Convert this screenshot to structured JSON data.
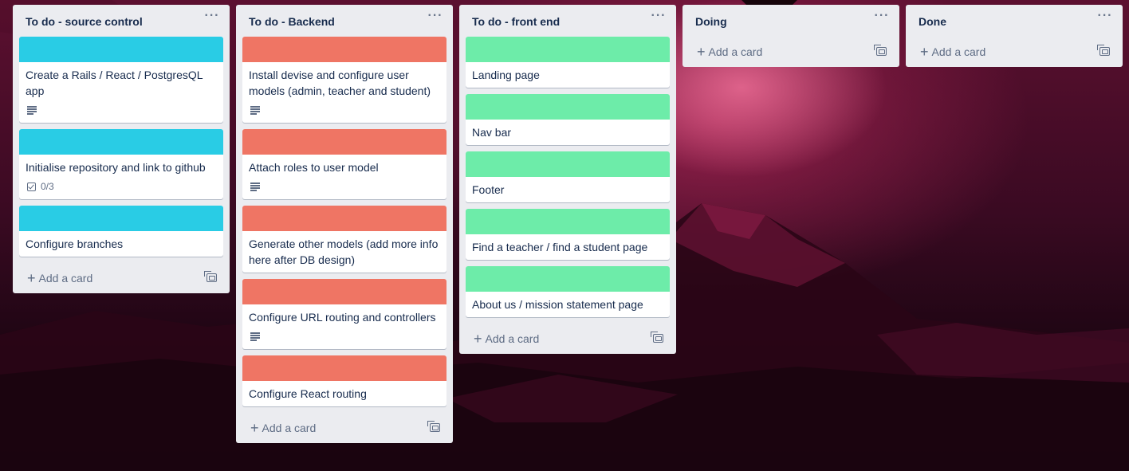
{
  "colors": {
    "label_source_control": "#29cce5",
    "label_backend": "#ef7564",
    "label_front_end": "#6deca9",
    "list_bg": "#ebecf0"
  },
  "lists": [
    {
      "title": "To do - source control",
      "menu": "···",
      "add_label": "Add a card",
      "cards": [
        {
          "title": "Create a Rails / React / PostgresQL app",
          "label_color": "#29cce5",
          "badges": "description"
        },
        {
          "title": "Initialise repository and link to github",
          "label_color": "#29cce5",
          "badges": "checklist",
          "checklist": "0/3"
        },
        {
          "title": "Configure branches",
          "label_color": "#29cce5",
          "badges": "none"
        }
      ]
    },
    {
      "title": "To do - Backend",
      "menu": "···",
      "add_label": "Add a card",
      "cards": [
        {
          "title": "Install devise and configure user models (admin, teacher and student)",
          "label_color": "#ef7564",
          "badges": "description"
        },
        {
          "title": "Attach roles to user model",
          "label_color": "#ef7564",
          "badges": "description"
        },
        {
          "title": "Generate other models (add more info here after DB design)",
          "label_color": "#ef7564",
          "badges": "none"
        },
        {
          "title": "Configure URL routing and controllers",
          "label_color": "#ef7564",
          "badges": "description"
        },
        {
          "title": "Configure React routing",
          "label_color": "#ef7564",
          "badges": "none"
        }
      ]
    },
    {
      "title": "To do - front end",
      "menu": "···",
      "add_label": "Add a card",
      "cards": [
        {
          "title": "Landing page",
          "label_color": "#6deca9",
          "badges": "none"
        },
        {
          "title": "Nav bar",
          "label_color": "#6deca9",
          "badges": "none"
        },
        {
          "title": "Footer",
          "label_color": "#6deca9",
          "badges": "none"
        },
        {
          "title": "Find a teacher / find a student page",
          "label_color": "#6deca9",
          "badges": "none"
        },
        {
          "title": "About us / mission statement page",
          "label_color": "#6deca9",
          "badges": "none"
        }
      ]
    },
    {
      "title": "Doing",
      "menu": "···",
      "add_label": "Add a card",
      "cards": []
    },
    {
      "title": "Done",
      "menu": "···",
      "add_label": "Add a card",
      "cards": []
    }
  ]
}
